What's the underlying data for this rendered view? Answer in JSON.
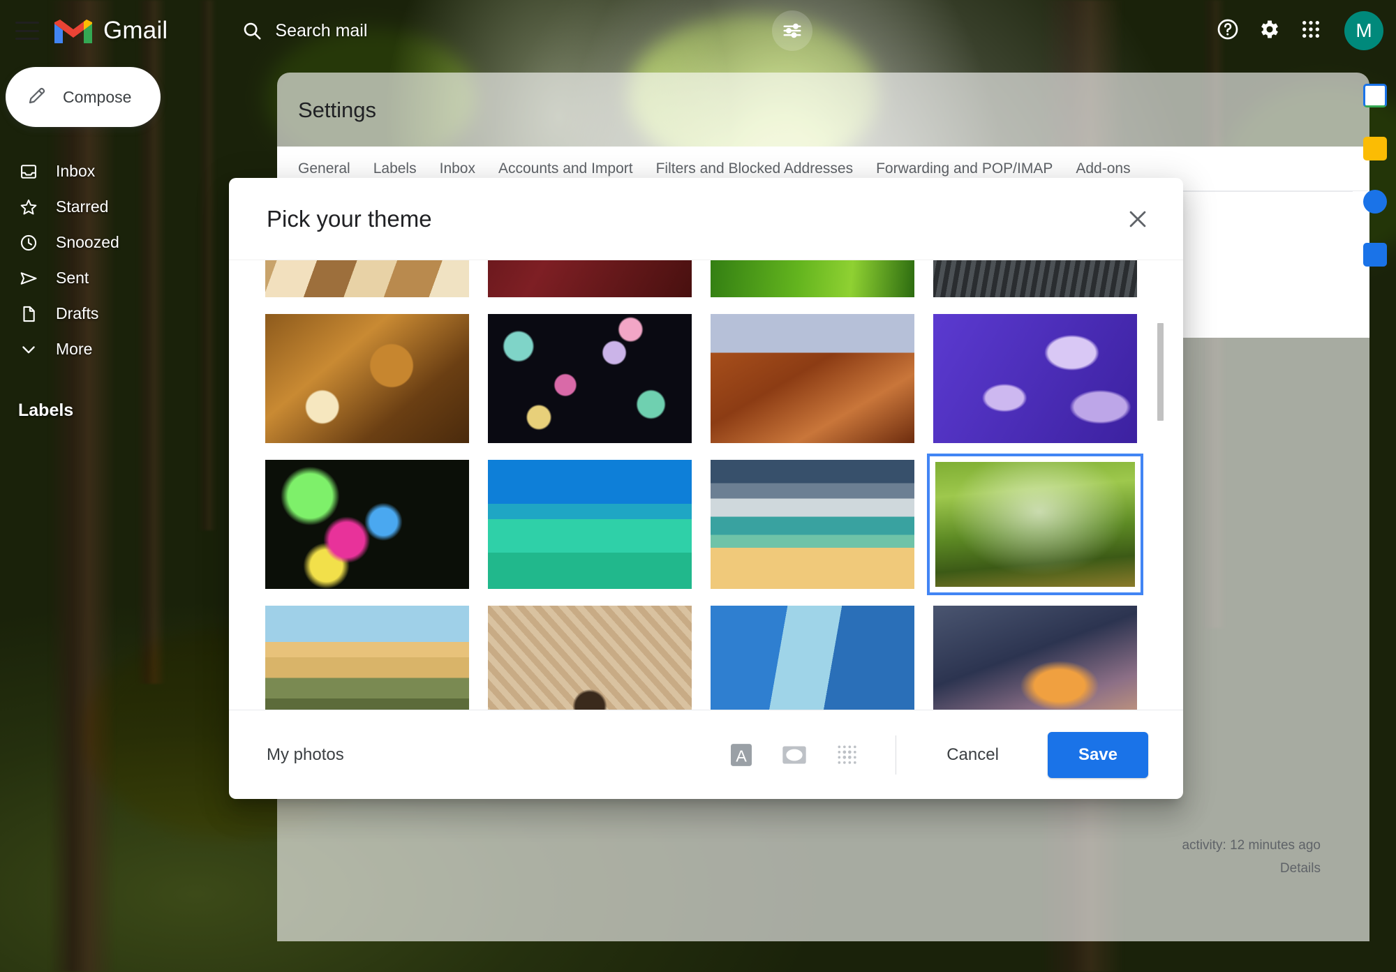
{
  "app": {
    "brand": "Gmail",
    "hamburger_icon": "hamburger-menu-icon",
    "logo_icon": "gmail-logo-icon"
  },
  "search": {
    "icon": "search-icon",
    "placeholder": "Search mail",
    "value": "",
    "tune_icon": "tune-options-icon"
  },
  "topbar_right": {
    "help_icon": "help-circle-icon",
    "settings_icon": "gear-icon",
    "apps_icon": "apps-grid-icon",
    "avatar_initial": "M"
  },
  "sidebar": {
    "compose": {
      "label": "Compose",
      "icon": "pencil-icon"
    },
    "items": [
      {
        "label": "Inbox",
        "icon": "inbox-icon"
      },
      {
        "label": "Starred",
        "icon": "star-icon"
      },
      {
        "label": "Snoozed",
        "icon": "clock-icon"
      },
      {
        "label": "Sent",
        "icon": "send-icon"
      },
      {
        "label": "Drafts",
        "icon": "file-icon"
      },
      {
        "label": "More",
        "icon": "chevron-down-icon"
      }
    ],
    "labels_heading": "Labels"
  },
  "settings": {
    "title": "Settings",
    "tabs": [
      "General",
      "Labels",
      "Inbox",
      "Accounts and Import",
      "Filters and Blocked Addresses",
      "Forwarding and POP/IMAP",
      "Add-ons"
    ],
    "activity_line": "activity: 12 minutes ago",
    "details_link": "Details"
  },
  "right_rail": {
    "items": [
      {
        "name": "calendar-icon",
        "color": "#1a73e8"
      },
      {
        "name": "keep-icon",
        "color": "#fbbc04"
      },
      {
        "name": "tasks-icon",
        "color": "#1a73e8"
      },
      {
        "name": "contacts-icon",
        "color": "#1a73e8"
      }
    ]
  },
  "dialog": {
    "title": "Pick your theme",
    "close_icon": "close-icon",
    "my_photos_label": "My photos",
    "tools": [
      {
        "name": "text-background-icon",
        "label": "A",
        "active": true
      },
      {
        "name": "vignette-icon",
        "label": "",
        "active": false
      },
      {
        "name": "blur-icon",
        "label": "",
        "active": false
      }
    ],
    "cancel_label": "Cancel",
    "save_label": "Save",
    "accent_color": "#1a73e8",
    "selection_color": "#4285f4",
    "scroll_position": "top",
    "themes": [
      {
        "id": "chess-wood",
        "name": "Wooden chess board",
        "selected": false
      },
      {
        "id": "dark-red",
        "name": "Dark red texture",
        "selected": false
      },
      {
        "id": "green-grass",
        "name": "Green grass blades",
        "selected": false
      },
      {
        "id": "dark-metal",
        "name": "Dark metallic waves",
        "selected": false
      },
      {
        "id": "autumn-leaves",
        "name": "Autumn leaves",
        "selected": false
      },
      {
        "id": "bokeh-lights",
        "name": "Colorful bokeh lights",
        "selected": false
      },
      {
        "id": "canyon-river",
        "name": "Canyon river bend",
        "selected": false
      },
      {
        "id": "jellyfish",
        "name": "Purple jellyfish",
        "selected": false
      },
      {
        "id": "neon-swirl",
        "name": "Neon light swirl",
        "selected": false
      },
      {
        "id": "turquoise-lake",
        "name": "Turquoise lake island",
        "selected": false
      },
      {
        "id": "storm-beach",
        "name": "Beach with storm clouds",
        "selected": false
      },
      {
        "id": "forest",
        "name": "Misty green forest",
        "selected": true
      },
      {
        "id": "coast-sunset",
        "name": "Coastal sunset bridge",
        "selected": false
      },
      {
        "id": "desert-rock",
        "name": "Cracked desert with rock",
        "selected": false
      },
      {
        "id": "city-towers",
        "name": "City skyscrapers",
        "selected": false
      },
      {
        "id": "sunset-clouds",
        "name": "Sunset storm clouds",
        "selected": false
      }
    ]
  }
}
